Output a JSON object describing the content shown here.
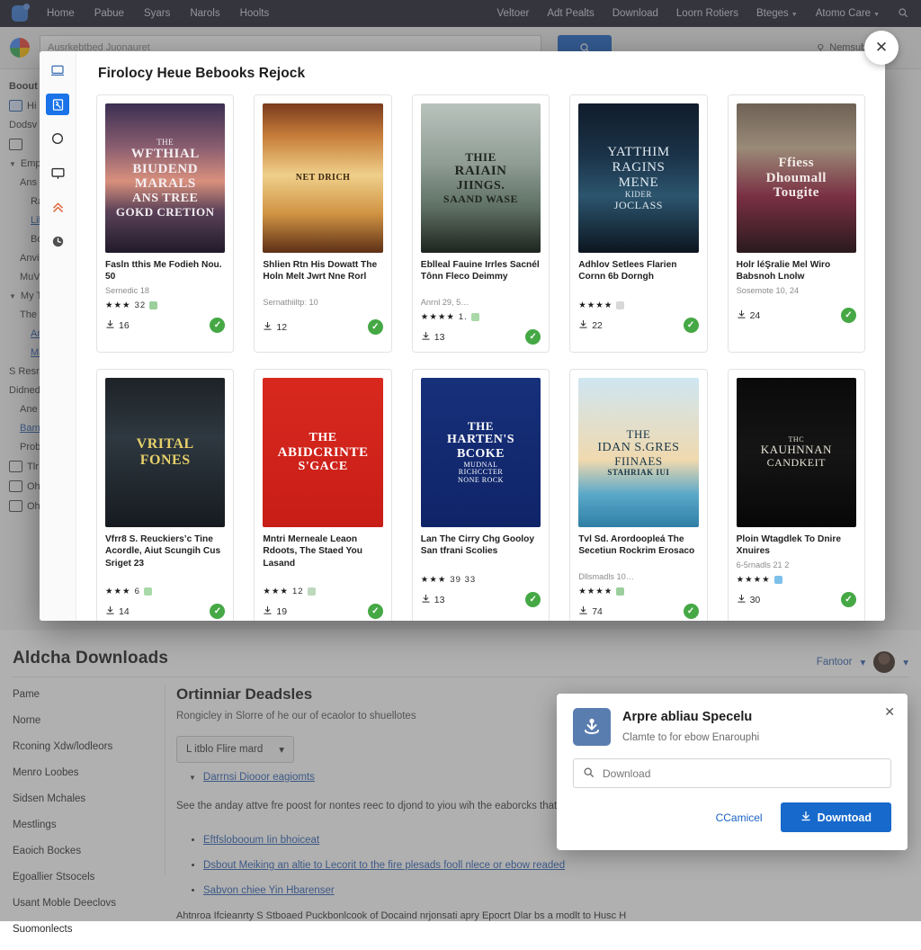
{
  "topnav": {
    "logo": "app-logo",
    "left_items": [
      {
        "label": "Home"
      },
      {
        "label": "Pabue"
      },
      {
        "label": "Syars"
      },
      {
        "label": "Narols"
      },
      {
        "label": "Hoolts"
      }
    ],
    "right_items": [
      {
        "label": "Veltoer",
        "caret": false
      },
      {
        "label": "Adt Pealts",
        "caret": false
      },
      {
        "label": "Download",
        "caret": false
      },
      {
        "label": "Loorn Rotiers",
        "caret": false
      },
      {
        "label": "Bteges",
        "caret": true
      },
      {
        "label": "Atomo Care",
        "caret": true
      }
    ],
    "search_icon": "search-icon"
  },
  "searchbar": {
    "value": "Ausrkebtbed Juonauret",
    "go_label": "",
    "right_label": "Nemsub ..es"
  },
  "bg_sidebar": {
    "items": [
      {
        "label": "Boout",
        "level": 0,
        "bold": true
      },
      {
        "label": "Hi",
        "level": 0,
        "icon": "chat-icon"
      },
      {
        "label": "Dodsv",
        "level": 0
      },
      {
        "label": "",
        "level": 0,
        "icon": "mail-icon"
      },
      {
        "label": "Empz",
        "level": 0,
        "tri": true
      },
      {
        "label": "Ans",
        "level": 1
      },
      {
        "label": "Raf",
        "level": 2
      },
      {
        "label": "Lib",
        "level": 2,
        "link": true
      },
      {
        "label": "Bor",
        "level": 2
      },
      {
        "label": "Anvire",
        "level": 1
      },
      {
        "label": "MuVi",
        "level": 1
      },
      {
        "label": "My Tv",
        "level": 0,
        "tri": true
      },
      {
        "label": "The",
        "level": 1
      },
      {
        "label": "Anf",
        "level": 2,
        "link": true
      },
      {
        "label": "Ma",
        "level": 2,
        "link": true
      },
      {
        "label": "S Resr",
        "level": 0
      },
      {
        "label": "Didned",
        "level": 0
      },
      {
        "label": "Ane",
        "level": 1
      },
      {
        "label": "Bam",
        "level": 1,
        "link": true
      },
      {
        "label": "Prob",
        "level": 1
      },
      {
        "label": "Tlr",
        "level": 0,
        "icon": "folder-icon"
      },
      {
        "label": "Oh",
        "level": 0,
        "icon": "card-icon"
      },
      {
        "label": "Oh",
        "level": 0,
        "icon": "bag-icon"
      }
    ]
  },
  "modal": {
    "title": "Firolocy Heue Bebooks Rejock",
    "close_label": "✕",
    "rail": [
      {
        "icon": "laptop-icon",
        "active": false
      },
      {
        "icon": "book-icon",
        "active": true
      },
      {
        "icon": "circle-icon",
        "active": false
      },
      {
        "icon": "monitor-icon",
        "active": false
      },
      {
        "icon": "upload-arrow-icon",
        "active": false
      },
      {
        "icon": "clock-icon",
        "active": false
      }
    ],
    "books": [
      {
        "cover_lines": [
          "THE",
          "WFTHIAL",
          "BIUDEND",
          "MARALS",
          "ANS TREE",
          "GOKD CRETION"
        ],
        "cover_style": "dusk-lake",
        "title": "Fasln tthis Me Fodieh Nou. 50",
        "meta": "Sernedic 18",
        "stars": 3,
        "rating_extra": "32",
        "badge_color": "#9ccf9c",
        "downloads": "16",
        "done": true
      },
      {
        "cover_lines": [
          "NET DRICH"
        ],
        "cover_style": "curtain-gold",
        "title": "Shlien Rtn His Dowatt The Holn Melt Jwrt Nne Rorl",
        "meta": "Sernathiiltpː 10",
        "stars": 0,
        "rating_extra": "",
        "badge_color": "",
        "downloads": "12",
        "done": true
      },
      {
        "cover_lines": [
          "THIE",
          "RAIAIN",
          "JIINGS.",
          "SAAND WASE"
        ],
        "cover_style": "misty-fjord",
        "title": "Eblleal Fauine Irrles Sacnél Tônn Fleco Deimmy",
        "meta": "Anrnl 29, 5…",
        "stars": 4,
        "rating_extra": "1.",
        "badge_color": "#a9d9a9",
        "downloads": "13",
        "done": true
      },
      {
        "cover_lines": [
          "YATTHIM",
          "RAGINS",
          "MENE",
          "KIDER",
          "JOCLASS"
        ],
        "cover_style": "night-sea",
        "title": "Adhlov Setlees Flarien Cornn 6b Dorngh",
        "meta": "",
        "stars": 4,
        "rating_extra": "",
        "badge_color": "#d8d8d8",
        "downloads": "22",
        "done": true
      },
      {
        "cover_lines": [
          "Ffiess",
          "Dhoumall",
          "Tougite"
        ],
        "cover_style": "red-dress",
        "title": "Holr léŞralie Mel Wiro Babsnoh Lnolw",
        "meta": "Sosemote 10, 24",
        "stars": 0,
        "rating_extra": "",
        "badge_color": "",
        "downloads": "24",
        "done": true
      },
      {
        "cover_lines": [
          "VRITAL",
          "FONES"
        ],
        "cover_style": "moon-portrait",
        "title": "Vfrr8 S. Reuckiers’c Tine Acordle, Aiut Scungih Cus Sriget 23",
        "meta": "",
        "stars": 3,
        "rating_extra": "6",
        "badge_color": "#a9d9a9",
        "downloads": "14",
        "done": true
      },
      {
        "cover_lines": [
          "THE",
          "ABIDCRINTE",
          "S'GACE"
        ],
        "cover_style": "red-silhouette",
        "title": "Mntri Merneale Leaon Rdoots, The Staed You Lasand",
        "meta": "",
        "stars": 3,
        "rating_extra": "12",
        "badge_color": "#bdd9bd",
        "downloads": "19",
        "done": true
      },
      {
        "cover_lines": [
          "THE",
          "HARTEN'S",
          "BCOKE",
          "MUDNAL",
          "RICHCCTER",
          "NONE ROCK"
        ],
        "cover_style": "navy-blue",
        "title": "Lan The Cirry Chg Gooloy San tfrani Scolies",
        "meta": "",
        "stars": 3,
        "rating_extra": "39 33",
        "badge_color": "",
        "downloads": "13",
        "done": true
      },
      {
        "cover_lines": [
          "THE",
          "IDAN S.GRES",
          "FIINAES",
          "STAHRIAK IUI"
        ],
        "cover_style": "beach-sky",
        "title": "Tvl Sd. Arordoopleá The Secetiun Rockrim Erosaco",
        "meta": "Dllsmadls 10…",
        "stars": 4,
        "rating_extra": "",
        "badge_color": "#9ccf9c",
        "downloads": "74",
        "done": true
      },
      {
        "cover_lines": [
          "THC",
          "KAUHNNAN",
          "CANDKEIT"
        ],
        "cover_style": "black-compass",
        "title": "Ploin Wtagdlek To Dnire Xnuires",
        "meta": "6-5rnadls 21 2",
        "stars": 4,
        "rating_extra": "",
        "badge_color": "#7cc0ea",
        "downloads": "30",
        "done": true
      }
    ]
  },
  "bottom_panel": {
    "title": "Aldcha Downloads",
    "user_label": "Fantoor",
    "left_nav": [
      "Pame",
      "Norne",
      "Rconing Xdw/lodleors",
      "Menro Loobes",
      "Sidsen Mchales",
      "Mestlings",
      "Eaoich Bockes",
      "Egoallier Stsocels",
      "Usant Moble Deeclovs",
      "Suomonlects"
    ],
    "main_heading": "Ortinniar Deadsles",
    "main_sub": "Rongicley in Slorre of he our of ecaolor to shuellotes",
    "select_value": "L itblo Flire mard",
    "disclosure_link": "Darrnsi Diooor eagiomts",
    "paragraph": "See the anday attve fre poost for nontes reec to djond to yiou wih the eaborcks that eon Bealigs.",
    "bullets": [
      "Eftfslobooum Iin bhoiceat",
      "Dsbout Meiking an altie to Lecorit to the fire plesads fooll nlece or ebow readed",
      "Sabvon chiee Yin Hbarenser"
    ],
    "footnote": "Ahtnroa Ifcieanrty S Stboaed Puckbonlcook of Docaind nrjonsati apry Epocrt Dlar bs a modlt to Husc H"
  },
  "download_dialog": {
    "icon": "download-app-icon",
    "title": "Arpre abliau Specelu",
    "subtitle": "Clamte to for ebow Enarouphi",
    "search_icon": "search-icon",
    "input_placeholder": "Download",
    "input_value": "",
    "cancel_label": "CCamicel",
    "download_label": "Downtoad",
    "download_icon": "download-arrow-icon",
    "close_label": "✕",
    "accent": "#1769cc"
  }
}
